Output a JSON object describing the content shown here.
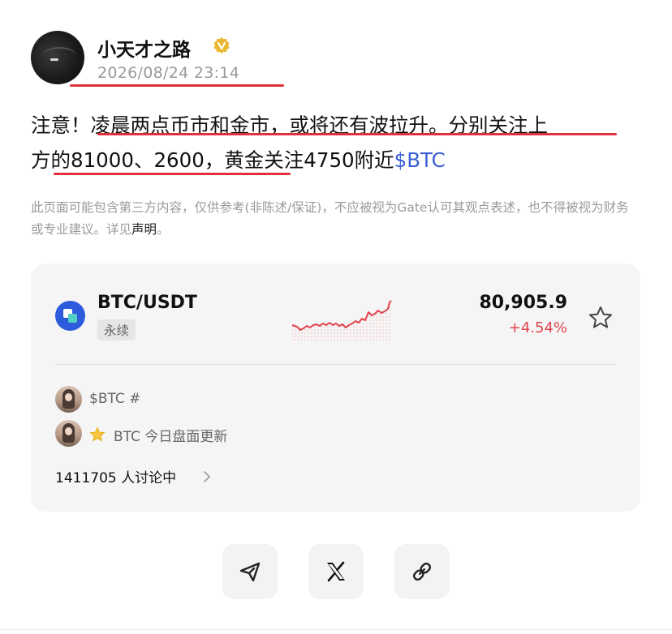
{
  "post": {
    "author": "小天才之路",
    "timestamp": "2026/08/24 23:14",
    "content_lines": [
      "注意！凌晨两点币市和金市，或将还有波拉升。分别关注上",
      "方的81000、2600，黄金关注4750附近"
    ],
    "cashtag": "$BTC",
    "disclaimer_text": "此页面可能包含第三方内容，仅供参考(非陈述/保证)，不应被视为Gate认可其观点表述，也不得被视为财务或专业建议。详见",
    "disclaimer_link": "声明",
    "disclaimer_end": "。"
  },
  "market_card": {
    "pair": "BTC/USDT",
    "badge": "永续",
    "price": "80,905.9",
    "change": "+4.54%",
    "topics": [
      {
        "text": "$BTC #"
      },
      {
        "text": "BTC 今日盘面更新"
      }
    ],
    "discussion_count": "1411705 人讨论中"
  },
  "colors": {
    "accent_red": "#e2303a",
    "cashtag_blue": "#3a5fd8",
    "positive_change": "#e2434f",
    "card_bg": "#f5f5f5"
  },
  "icons": {
    "verified": "verified-badge-icon",
    "coin": "gate-coin-icon",
    "favorite": "star-outline-icon",
    "topic_star": "star-icon",
    "arrow": "chevron-right-icon",
    "share": [
      "send-icon",
      "x-logo-icon",
      "link-icon"
    ]
  }
}
